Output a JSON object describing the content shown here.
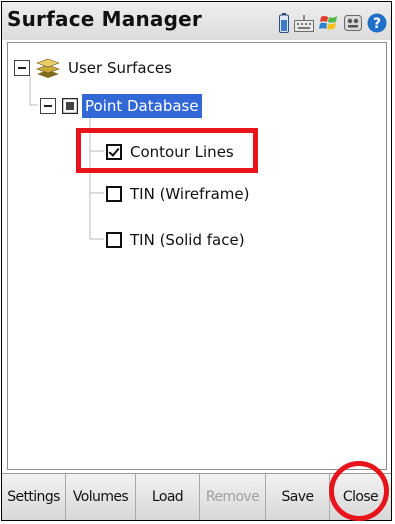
{
  "window": {
    "title": "Surface Manager",
    "status_icons": [
      "battery-icon",
      "keyboard-icon",
      "windows-flag-icon",
      "speaker-icon",
      "help-icon"
    ]
  },
  "tree": {
    "root": {
      "label": "User Surfaces",
      "icon": "layers-icon",
      "expanded": true
    },
    "database": {
      "label": "Point Database",
      "icon": "database-icon",
      "expanded": true,
      "selected": true
    },
    "items": [
      {
        "label": "Contour Lines",
        "checked": true,
        "highlighted": true
      },
      {
        "label": "TIN (Wireframe)",
        "checked": false
      },
      {
        "label": "TIN (Solid face)",
        "checked": false
      }
    ]
  },
  "toolbar": {
    "settings_label": "Settings",
    "volumes_label": "Volumes",
    "load_label": "Load",
    "remove_label": "Remove",
    "remove_disabled": true,
    "save_label": "Save",
    "close_label": "Close",
    "close_highlighted": true
  },
  "colors": {
    "selection": "#3168d5",
    "annotation_red": "#e8141c",
    "disabled_text": "#a0a0a0"
  }
}
